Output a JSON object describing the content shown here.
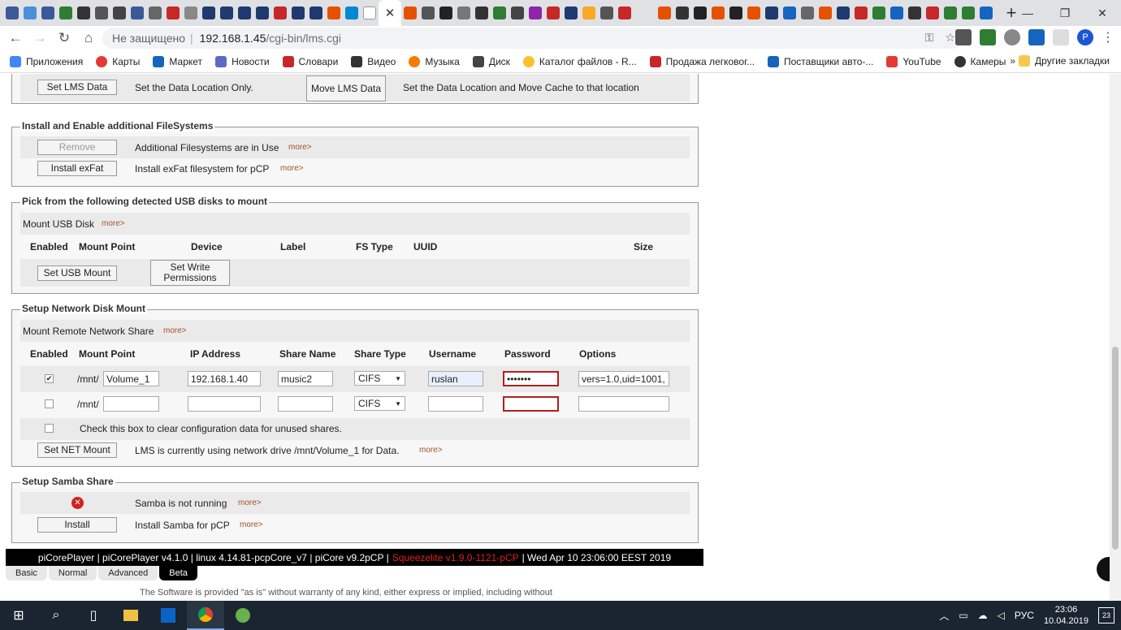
{
  "browser": {
    "active_tab_close": "✕",
    "new_tab": "+",
    "url_security": "Не защищено",
    "url_host": "192.168.1.45",
    "url_path": "/cgi-bin/lms.cgi",
    "bookmarks": [
      "Приложения",
      "Карты",
      "Маркет",
      "Новости",
      "Словари",
      "Видео",
      "Музыка",
      "Диск",
      "Каталог файлов - R...",
      "Продажа легковог...",
      "Поставщики авто-...",
      "YouTube",
      "Камеры"
    ],
    "bookmarks_more": "»",
    "other_bookmarks": "Другие закладки",
    "profile_initial": "P"
  },
  "lms_section": {
    "set_lms_button": "Set LMS Data",
    "set_lms_text": "Set the Data Location Only.",
    "move_lms_button": "Move LMS Data",
    "move_lms_text": "Set the Data Location and Move Cache to that location"
  },
  "filesystems": {
    "legend": "Install and Enable additional FileSystems",
    "remove_button": "Remove",
    "remove_text": "Additional Filesystems are in Use",
    "exfat_button": "Install exFat",
    "exfat_text": "Install exFat filesystem for pCP",
    "more": "more>"
  },
  "usb": {
    "legend": "Pick from the following detected USB disks to mount",
    "mount_text": "Mount USB Disk",
    "more": "more>",
    "headers": [
      "Enabled",
      "Mount Point",
      "Device",
      "Label",
      "FS Type",
      "UUID",
      "Size"
    ],
    "set_usb_button": "Set USB Mount",
    "write_perm_button": "Set Write Permissions"
  },
  "network": {
    "legend": "Setup Network Disk Mount",
    "mount_text": "Mount Remote Network Share",
    "more": "more>",
    "headers": [
      "Enabled",
      "Mount Point",
      "IP Address",
      "Share Name",
      "Share Type",
      "Username",
      "Password",
      "Options"
    ],
    "rows": [
      {
        "enabled": "✔",
        "prefix": "/mnt/",
        "mount": "Volume_1",
        "ip": "192.168.1.40",
        "share": "music2",
        "type": "CIFS",
        "user": "ruslan",
        "password": "•••••••",
        "options": "vers=1.0,uid=1001,"
      },
      {
        "enabled": "",
        "prefix": "/mnt/",
        "mount": "",
        "ip": "",
        "share": "",
        "type": "CIFS",
        "user": "",
        "password": "",
        "options": ""
      }
    ],
    "clear_text": "Check this box to clear configuration data for unused shares.",
    "set_net_button": "Set NET Mount",
    "status_text": "LMS is currently using network drive /mnt/Volume_1 for Data."
  },
  "samba": {
    "legend": "Setup Samba Share",
    "status_icon": "✕",
    "status_text": "Samba is not running",
    "install_button": "Install",
    "install_text": "Install Samba for pCP",
    "more": "more>"
  },
  "footer": {
    "left": "piCorePlayer | piCorePlayer v4.1.0 | linux 4.14.81-pcpCore_v7 | piCore v9.2pCP |",
    "squeezelite": "Squeezelite v1.9.0-1121-pCP",
    "right": "| Wed Apr 10 23:06:00 EEST 2019",
    "modes": [
      "Basic",
      "Normal",
      "Advanced",
      "Beta"
    ],
    "disclaimer": "The Software is provided \"as is\" without warranty of any kind, either express or implied, including without"
  },
  "taskbar": {
    "lang": "РУС",
    "time": "23:06",
    "date": "10.04.2019",
    "notifications": "23"
  },
  "colors": {
    "accent_red": "#b02020",
    "footer_bg": "#000000",
    "taskbar_bg": "#1b2531"
  }
}
